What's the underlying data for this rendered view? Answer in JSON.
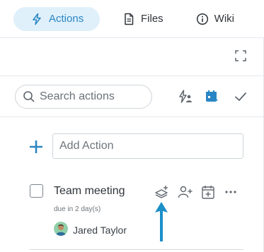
{
  "tabs": [
    {
      "label": "Actions",
      "icon": "lightning-icon",
      "active": true
    },
    {
      "label": "Files",
      "icon": "file-icon",
      "active": false
    },
    {
      "label": "Wiki",
      "icon": "info-circle-icon",
      "active": false
    }
  ],
  "search": {
    "placeholder": "Search actions"
  },
  "toolbar": {
    "icons": [
      "assigned-actions-icon",
      "calendar-filter-icon",
      "checkmark-icon"
    ]
  },
  "add_action": {
    "placeholder": "Add Action"
  },
  "action_item": {
    "title": "Team meeting",
    "due": "due in 2 day(s)",
    "assignee": "Jared Taylor",
    "icons": [
      "layers-add-icon",
      "add-user-icon",
      "calendar-add-icon",
      "more-icon"
    ]
  },
  "colors": {
    "accent": "#2a86c4",
    "active_tab_bg": "#dff0fb",
    "arrow": "#1a8fc8"
  }
}
